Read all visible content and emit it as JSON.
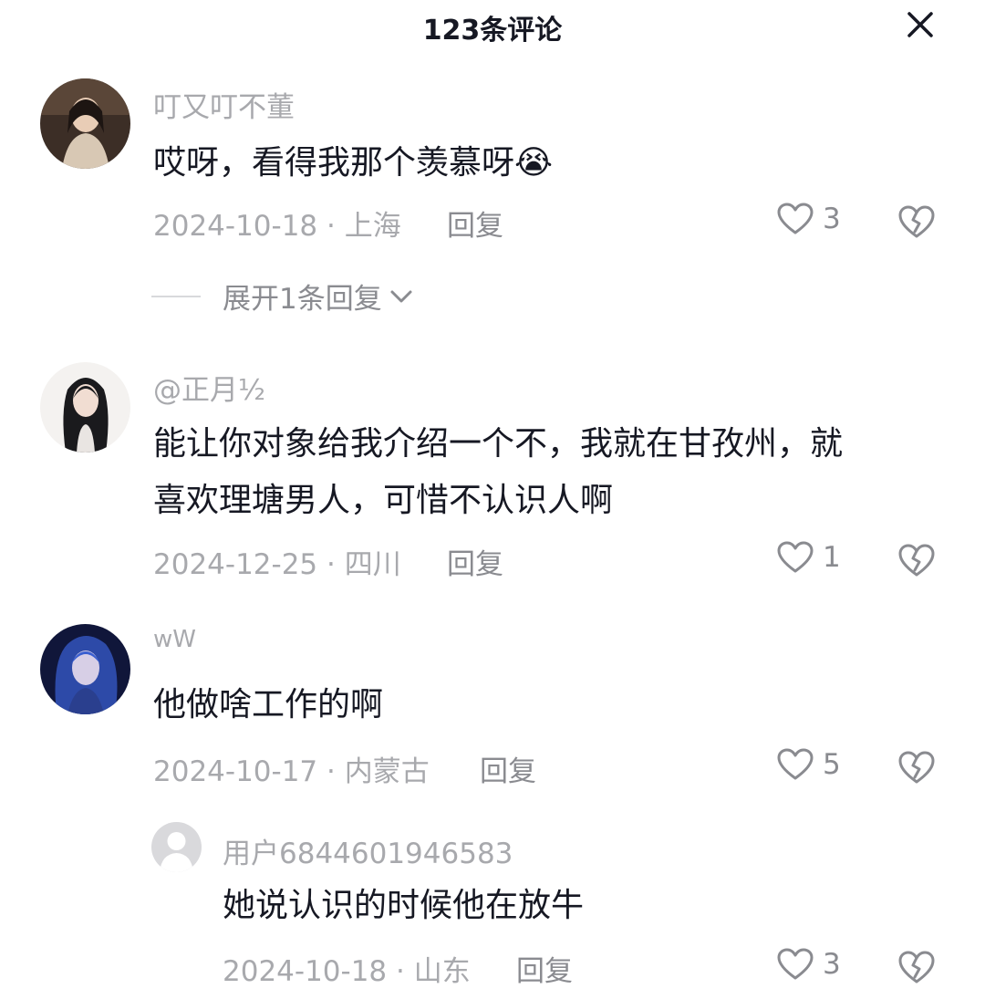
{
  "header": {
    "title": "123条评论"
  },
  "comments": [
    {
      "username": "叮又叮不董",
      "text": "哎呀，看得我那个羡慕呀",
      "emoji": "😭",
      "date": "2024-10-18",
      "location": "上海",
      "reply_label": "回复",
      "likes": "3",
      "expand_label": "展开1条回复"
    },
    {
      "username": "@正月½",
      "text_line1": "能让你对象给我介绍一个不，我就在甘孜州，就",
      "text_line2": "喜欢理塘男人，可惜不认识人啊",
      "date": "2024-12-25",
      "location": "四川",
      "reply_label": "回复",
      "likes": "1"
    },
    {
      "username": "wW",
      "text": "他做啥工作的啊",
      "date": "2024-10-17",
      "location": "内蒙古",
      "reply_label": "回复",
      "likes": "5"
    }
  ],
  "subreply": {
    "username": "用户6844601946583",
    "text": "她说认识的时候他在放牛",
    "date": "2024-10-18",
    "location": "山东",
    "reply_label": "回复",
    "likes": "3"
  },
  "separator": "·",
  "icons": {
    "close": "close-icon",
    "like": "heart-outline-icon",
    "dislike": "broken-heart-icon"
  },
  "colors": {
    "text": "#161823",
    "muted": "#a8a9ad",
    "action": "#8a8b90"
  }
}
